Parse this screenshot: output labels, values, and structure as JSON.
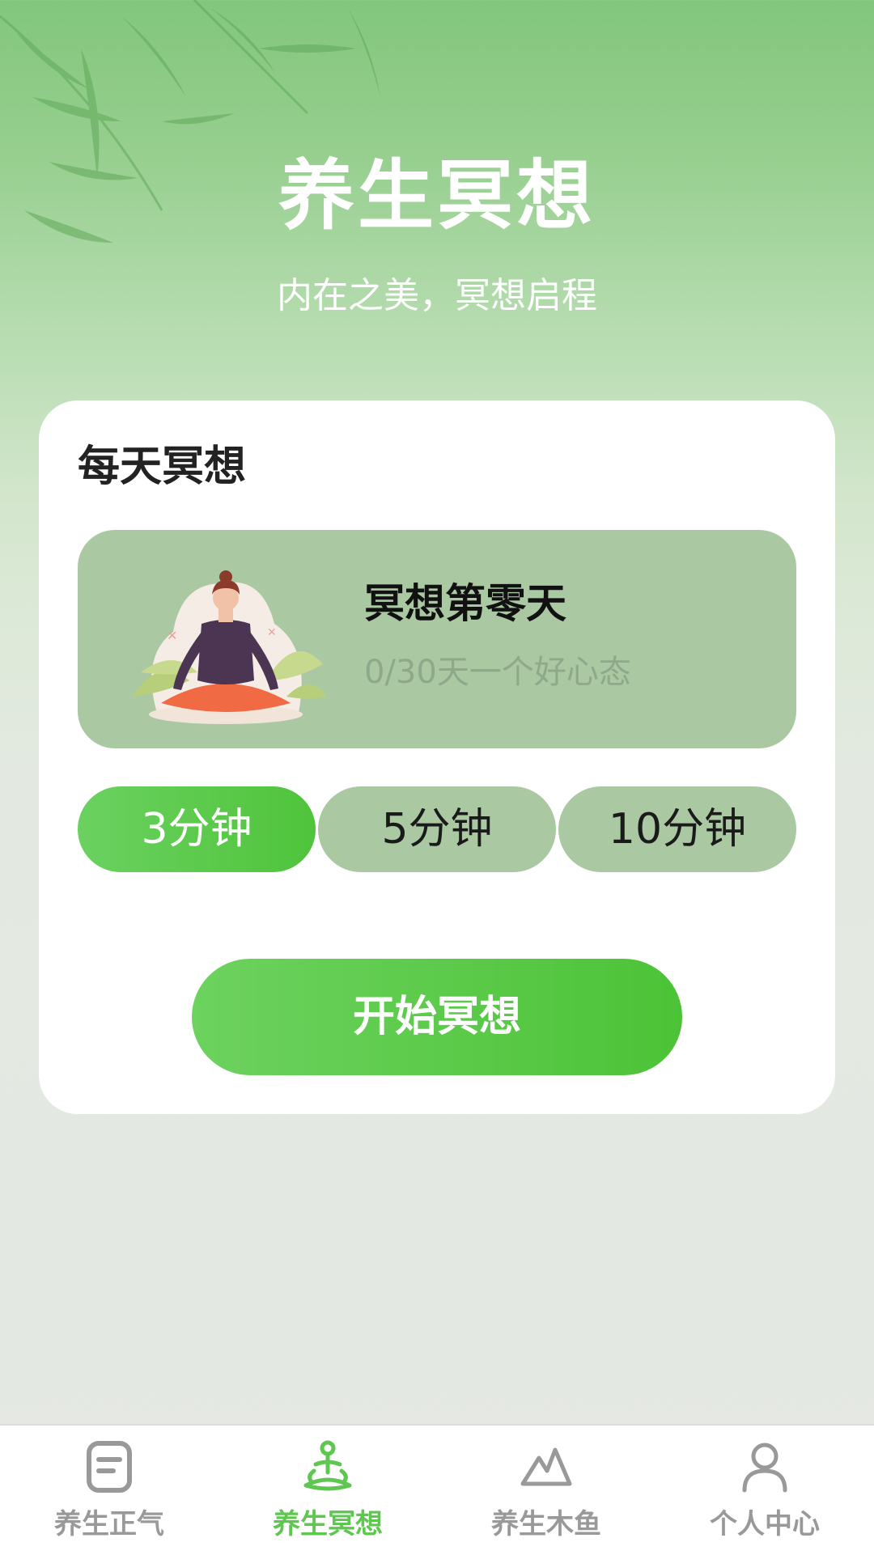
{
  "hero": {
    "title": "养生冥想",
    "subtitle": "内在之美，冥想启程"
  },
  "card": {
    "title": "每天冥想",
    "progress": {
      "title": "冥想第零天",
      "subtitle": "0/30天一个好心态",
      "illustration_icon": "meditation-illustration"
    },
    "durations": [
      {
        "label": "3分钟",
        "selected": true
      },
      {
        "label": "5分钟",
        "selected": false
      },
      {
        "label": "10分钟",
        "selected": false
      }
    ],
    "start_label": "开始冥想"
  },
  "tabbar": {
    "tabs": [
      {
        "label": "养生正气",
        "icon": "document-icon",
        "active": false
      },
      {
        "label": "养生冥想",
        "icon": "meditation-icon",
        "active": true
      },
      {
        "label": "养生木鱼",
        "icon": "mountain-icon",
        "active": false
      },
      {
        "label": "个人中心",
        "icon": "person-icon",
        "active": false
      }
    ]
  },
  "colors": {
    "accent": "#5ec74f",
    "panel": "#aac9a3",
    "inactive": "#999999"
  }
}
